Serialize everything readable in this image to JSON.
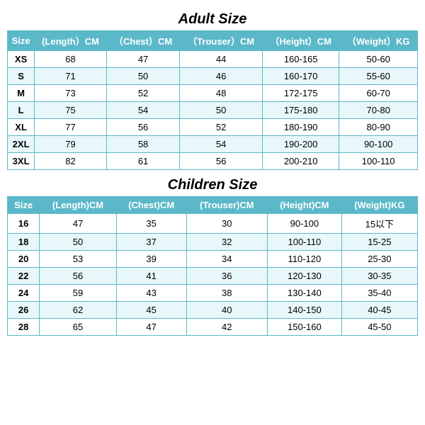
{
  "adult": {
    "title": "Adult Size",
    "headers": [
      "Size",
      "(Length）CM",
      "（Chest）CM",
      "（Trouser）CM",
      "（Height）CM",
      "（Weight）KG"
    ],
    "rows": [
      [
        "XS",
        "68",
        "47",
        "44",
        "160-165",
        "50-60"
      ],
      [
        "S",
        "71",
        "50",
        "46",
        "160-170",
        "55-60"
      ],
      [
        "M",
        "73",
        "52",
        "48",
        "172-175",
        "60-70"
      ],
      [
        "L",
        "75",
        "54",
        "50",
        "175-180",
        "70-80"
      ],
      [
        "XL",
        "77",
        "56",
        "52",
        "180-190",
        "80-90"
      ],
      [
        "2XL",
        "79",
        "58",
        "54",
        "190-200",
        "90-100"
      ],
      [
        "3XL",
        "82",
        "61",
        "56",
        "200-210",
        "100-110"
      ]
    ]
  },
  "children": {
    "title": "Children Size",
    "headers": [
      "Size",
      "(Length)CM",
      "(Chest)CM",
      "(Trouser)CM",
      "(Height)CM",
      "(Weight)KG"
    ],
    "rows": [
      [
        "16",
        "47",
        "35",
        "30",
        "90-100",
        "15以下"
      ],
      [
        "18",
        "50",
        "37",
        "32",
        "100-110",
        "15-25"
      ],
      [
        "20",
        "53",
        "39",
        "34",
        "110-120",
        "25-30"
      ],
      [
        "22",
        "56",
        "41",
        "36",
        "120-130",
        "30-35"
      ],
      [
        "24",
        "59",
        "43",
        "38",
        "130-140",
        "35-40"
      ],
      [
        "26",
        "62",
        "45",
        "40",
        "140-150",
        "40-45"
      ],
      [
        "28",
        "65",
        "47",
        "42",
        "150-160",
        "45-50"
      ]
    ]
  }
}
